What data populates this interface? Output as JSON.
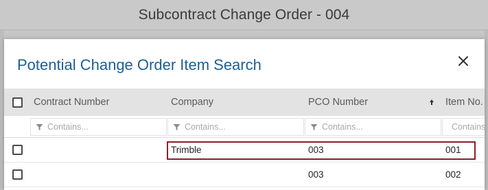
{
  "background": {
    "title": "Subcontract Change Order - 004"
  },
  "modal": {
    "title": "Potential Change Order Item Search",
    "close_icon": "close-icon"
  },
  "grid": {
    "columns": [
      {
        "label": "Contract Number"
      },
      {
        "label": "Company"
      },
      {
        "label": "PCO Number",
        "sort": "ascending"
      },
      {
        "label": "Item No."
      }
    ],
    "filter_placeholder": "Contains...",
    "rows": [
      {
        "contract_number": "",
        "company": "Trimble",
        "pco_number": "003",
        "item_no": "001",
        "highlighted": true
      },
      {
        "contract_number": "",
        "company": "",
        "pco_number": "003",
        "item_no": "002",
        "highlighted": false
      }
    ]
  },
  "colors": {
    "title_blue": "#1c5f95",
    "highlight_border": "#8b1e2b",
    "header_bg": "#e3e3e3"
  }
}
